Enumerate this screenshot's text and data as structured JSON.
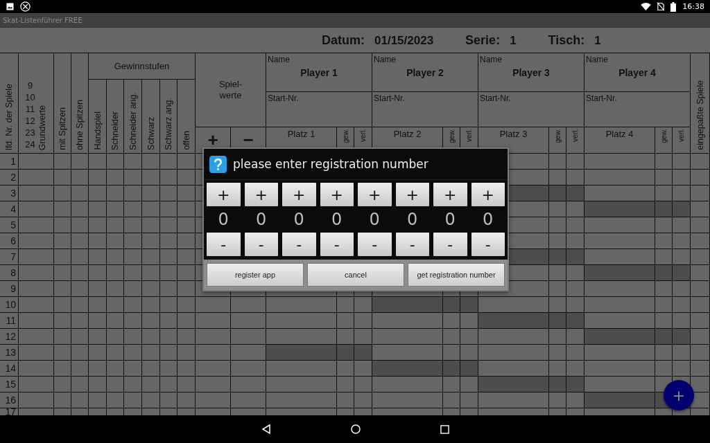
{
  "status_bar": {
    "time": "16:38"
  },
  "app_bar": {
    "title": "Skat-Listenführer FREE"
  },
  "sheet_header": [
    {
      "label": "Datum:",
      "value": "01/15/2023"
    },
    {
      "label": "Serie:",
      "value": "1"
    },
    {
      "label": "Tisch:",
      "value": "1"
    }
  ],
  "table": {
    "number_column": "lfd. Nr. der Spiele",
    "base_values": [
      "9",
      "10",
      "11",
      "12",
      "23",
      "24"
    ],
    "base_values_label": "Grundwerte",
    "matador_columns": [
      "mit Spitzen",
      "ohne Spitzen"
    ],
    "levels_title": "Gewinnstufen",
    "levels": [
      "Handspiel",
      "Schneider",
      "Schneider ang.",
      "Schwarz",
      "Schwarz ang.",
      "offen"
    ],
    "game_values": {
      "label": "Spiel-\nwerte",
      "plus": "+",
      "minus": "−"
    },
    "players": [
      {
        "name_label": "Name",
        "name": "Player 1",
        "start_label": "Start-Nr.",
        "place": "Platz 1",
        "won": "gew.",
        "lost": "verl."
      },
      {
        "name_label": "Name",
        "name": "Player 2",
        "start_label": "Start-Nr.",
        "place": "Platz 2",
        "won": "gew.",
        "lost": "verl."
      },
      {
        "name_label": "Name",
        "name": "Player 3",
        "start_label": "Start-Nr.",
        "place": "Platz 3",
        "won": "gew.",
        "lost": "verl."
      },
      {
        "name_label": "Name",
        "name": "Player 4",
        "start_label": "Start-Nr.",
        "place": "Platz 4",
        "won": "gew.",
        "lost": "verl."
      }
    ],
    "adjusted_games": "eingepaßte Spiele",
    "rows": [
      {
        "number": "1",
        "shaded": {
          "player_3": false,
          "player_4": false
        }
      },
      {
        "number": "2",
        "shaded": {
          "player_3": false,
          "player_4": false
        }
      },
      {
        "number": "3",
        "shaded": {
          "player_3": true,
          "player_4": false
        }
      },
      {
        "number": "4",
        "shaded": {
          "player_3": false,
          "player_4": true
        }
      },
      {
        "number": "5",
        "shaded": {
          "player_3": false,
          "player_4": false
        }
      },
      {
        "number": "6",
        "shaded": {
          "player_3": false,
          "player_4": false
        }
      },
      {
        "number": "7",
        "shaded": {
          "player_3": true,
          "player_4": false
        }
      },
      {
        "number": "8",
        "shaded": {
          "player_3": false,
          "player_4": true
        }
      },
      {
        "number": "9",
        "shaded": {
          "player_1": false,
          "player_2": false,
          "player_3": false,
          "player_4": false
        }
      },
      {
        "number": "10",
        "shaded": {
          "player_1": false,
          "player_2": true,
          "player_3": false,
          "player_4": false
        }
      },
      {
        "number": "11",
        "shaded": {
          "player_1": false,
          "player_2": false,
          "player_3": true,
          "player_4": false
        }
      },
      {
        "number": "12",
        "shaded": {
          "player_1": false,
          "player_2": false,
          "player_3": false,
          "player_4": true
        }
      },
      {
        "number": "13",
        "shaded": {
          "player_1": true,
          "player_2": false,
          "player_3": false,
          "player_4": false
        }
      },
      {
        "number": "14",
        "shaded": {
          "player_1": false,
          "player_2": true,
          "player_3": false,
          "player_4": false
        }
      },
      {
        "number": "15",
        "shaded": {
          "player_1": false,
          "player_2": false,
          "player_3": true,
          "player_4": false
        }
      },
      {
        "number": "16",
        "shaded": {
          "player_1": false,
          "player_2": false,
          "player_3": false,
          "player_4": true
        }
      },
      {
        "number": "17",
        "shaded": {
          "player_1": false,
          "player_2": false,
          "player_3": false,
          "player_4": false
        }
      }
    ]
  },
  "dialog": {
    "title": "please enter registration number",
    "digits": [
      {
        "plus": "+",
        "value": "0",
        "minus": "-"
      },
      {
        "plus": "+",
        "value": "0",
        "minus": "-"
      },
      {
        "plus": "+",
        "value": "0",
        "minus": "-"
      },
      {
        "plus": "+",
        "value": "0",
        "minus": "-"
      },
      {
        "plus": "+",
        "value": "0",
        "minus": "-"
      },
      {
        "plus": "+",
        "value": "0",
        "minus": "-"
      },
      {
        "plus": "+",
        "value": "0",
        "minus": "-"
      },
      {
        "plus": "+",
        "value": "0",
        "minus": "-"
      }
    ],
    "buttons": [
      "register app",
      "cancel",
      "get registration number"
    ]
  },
  "fab": {
    "label": "+"
  }
}
